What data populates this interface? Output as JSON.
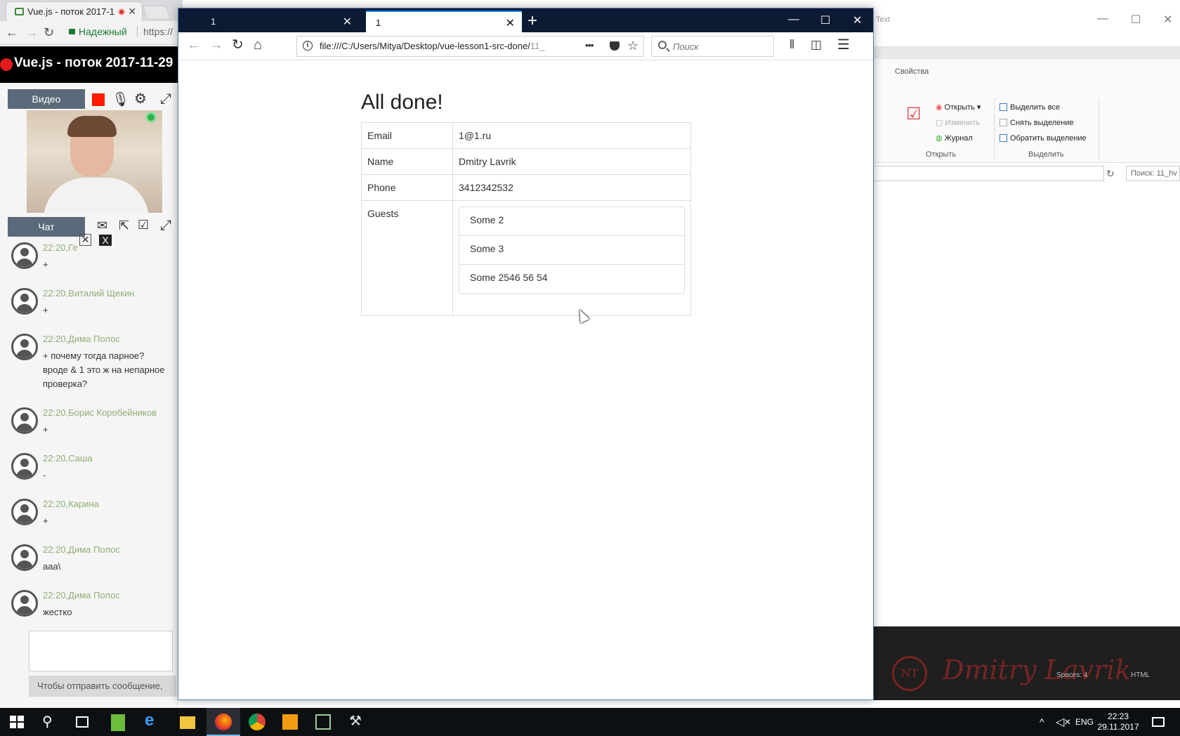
{
  "chrome": {
    "tab_title": "Vue.js - поток 2017-1",
    "secure_label": "Надежный",
    "url_fragment": "https://"
  },
  "webinar": {
    "title": "Vue.js - поток 2017-11-29",
    "video_tab": "Видео",
    "chat_tab": "Чат",
    "send_hint": "Чтобы отправить сообщение,",
    "messages": [
      {
        "meta": "22:20,Ге",
        "text": "+"
      },
      {
        "meta": "22:20,Виталий Щекин",
        "text": "+"
      },
      {
        "meta": "22:20,Дима Полос",
        "text": "+ почему тогда парное? вроде & 1 это ж на непарное проверка?"
      },
      {
        "meta": "22:20,Борис Коробейников",
        "text": "+"
      },
      {
        "meta": "22:20,Саша",
        "text": "-"
      },
      {
        "meta": "22:20,Карина",
        "text": "+"
      },
      {
        "meta": "22:20,Дима Полос",
        "text": "aaa\\"
      },
      {
        "meta": "22:20,Дима Полос",
        "text": "жестко"
      }
    ]
  },
  "explorer": {
    "title_fragment": "Text",
    "open_label": "Открыть",
    "edit_label": "Изменить",
    "history_label": "Журнал",
    "properties_label": "Свойства",
    "select_all": "Выделить все",
    "deselect": "Снять выделение",
    "invert": "Обратить выделение",
    "group_open": "Открыть",
    "group_select": "Выделить",
    "search_placeholder": "Поиск: 11_hv",
    "status_spaces": "Spaces: 4",
    "status_lang": "HTML",
    "watermark": "Dmitry Lavrik",
    "watermark_logo": "NT"
  },
  "firefox": {
    "tab1_title": "1",
    "tab2_title": "1",
    "url": "file:///C:/Users/Mitya/Desktop/vue-lesson1-src-done/",
    "url_faded": "11_",
    "search_placeholder": "Поиск"
  },
  "page": {
    "heading": "All done!",
    "rows": [
      {
        "label": "Email",
        "value": "1@1.ru"
      },
      {
        "label": "Name",
        "value": "Dmitry Lavrik"
      },
      {
        "label": "Phone",
        "value": "3412342532"
      }
    ],
    "guests_label": "Guests",
    "guests": [
      "Some 2",
      "Some 3",
      "Some 2546 56 54"
    ]
  },
  "taskbar": {
    "lang": "ENG",
    "time": "22:23",
    "date": "29.11.2017"
  },
  "colors": {
    "firefox_titlebar": "#0c1a33",
    "firefox_accent": "#0a84ff",
    "chat_name": "#8fae75",
    "record": "#ff1a00"
  }
}
